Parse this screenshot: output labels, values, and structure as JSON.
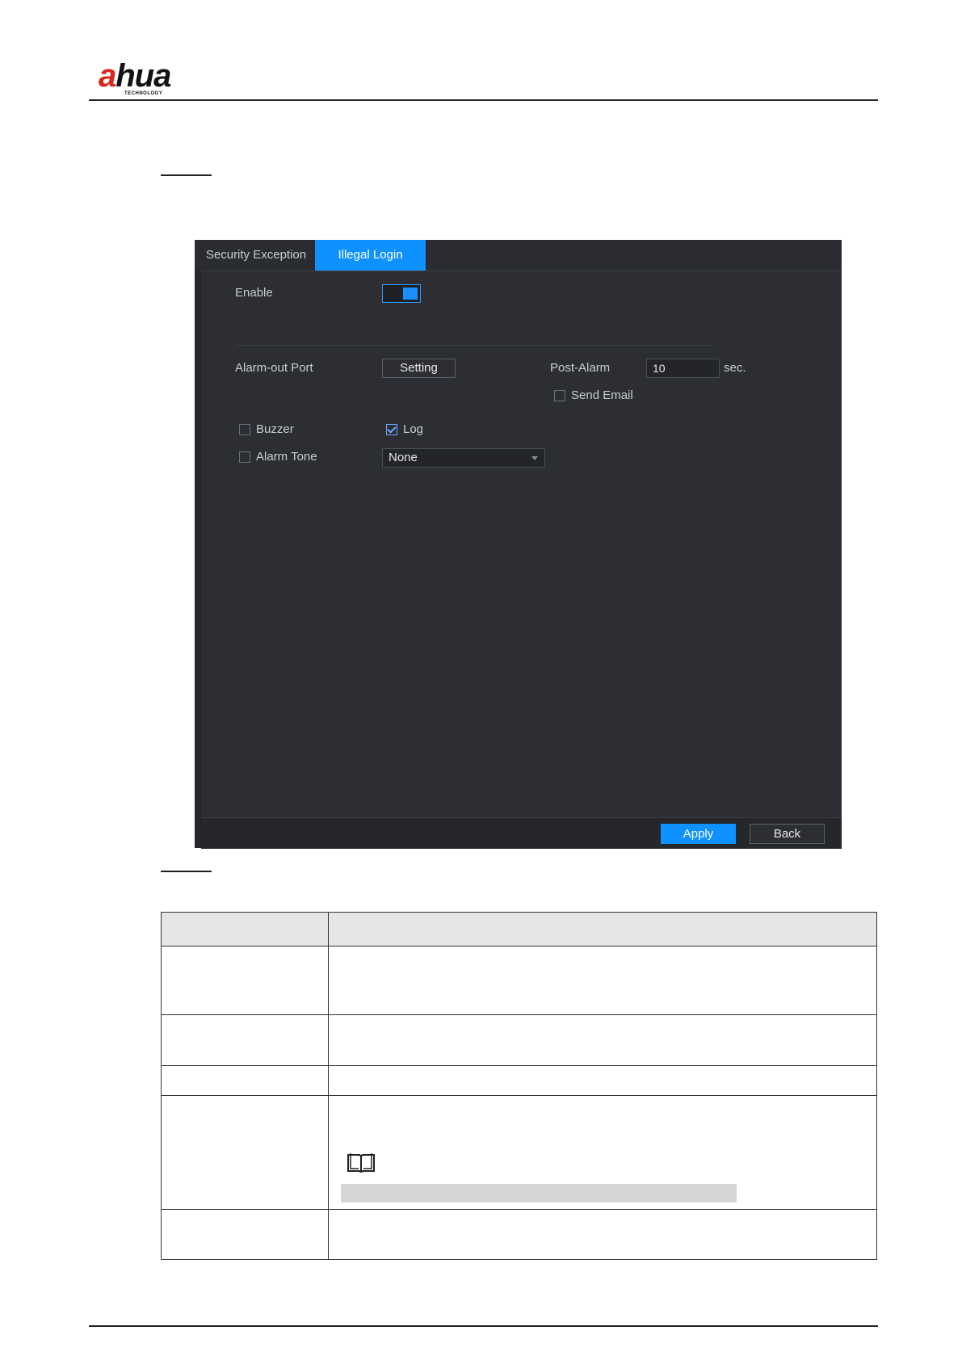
{
  "header": {
    "logo_text_a": "a",
    "logo_text_rest": "hua",
    "logo_subtext": "TECHNOLOGY"
  },
  "dialog": {
    "tabs": [
      {
        "label": "Security Exception",
        "active": false
      },
      {
        "label": "Illegal Login",
        "active": true
      }
    ],
    "enable_label": "Enable",
    "enable_on": true,
    "alarm_out_label": "Alarm-out Port",
    "setting_button": "Setting",
    "post_alarm_label": "Post-Alarm",
    "post_alarm_value": "10",
    "post_alarm_unit": "sec.",
    "send_email_label": "Send Email",
    "send_email_checked": false,
    "buzzer_label": "Buzzer",
    "buzzer_checked": false,
    "log_label": "Log",
    "log_checked": true,
    "alarm_tone_label": "Alarm Tone",
    "alarm_tone_checked": false,
    "alarm_tone_value": "None",
    "apply_button": "Apply",
    "back_button": "Back"
  },
  "colors": {
    "accent": "#0f92ff",
    "panel": "#2c2e33",
    "brand_red": "#d9261c"
  },
  "icons": {
    "note": "open-book-icon"
  }
}
